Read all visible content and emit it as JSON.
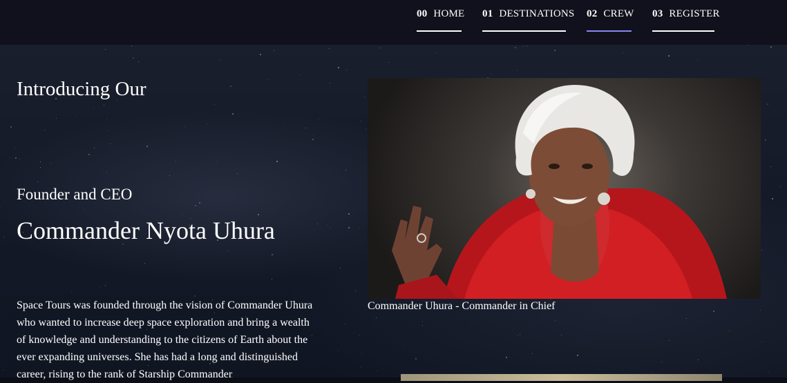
{
  "nav": {
    "items": [
      {
        "num": "00",
        "label": "HOME"
      },
      {
        "num": "01",
        "label": "DESTINATIONS"
      },
      {
        "num": "02",
        "label": "CREW"
      },
      {
        "num": "03",
        "label": "REGISTER"
      }
    ],
    "active_index": 2,
    "active_color": "#8a88f0"
  },
  "crew": {
    "intro": "Introducing Our",
    "role": "Founder and CEO",
    "name": "Commander Nyota Uhura",
    "bio": "Space Tours was founded through the vision of Commander Uhura who wanted to increase deep space exploration and bring a wealth of knowledge and understanding to the citizens of Earth about the ever expanding universes. She has had a long and distinguished career, rising to the rank of Starship Commander",
    "photo_caption": "Commander Uhura - Commander in Chief"
  },
  "colors": {
    "background": "#0b0d17",
    "nav_background": "#10111d",
    "text": "#ffffff"
  }
}
